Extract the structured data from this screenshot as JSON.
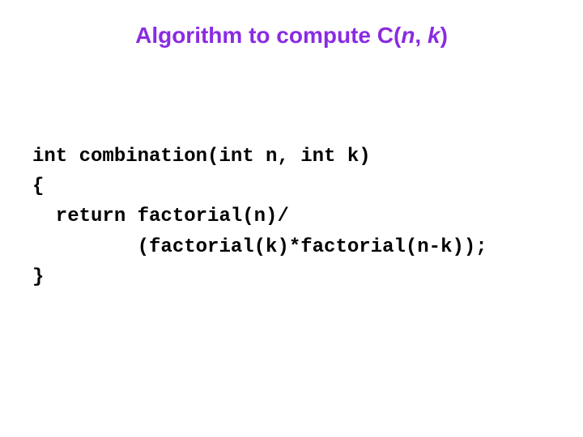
{
  "title": {
    "prefix": "Algorithm to compute ",
    "func": "C",
    "open": "(",
    "arg1": "n",
    "sep": ", ",
    "arg2": "k",
    "close": ")"
  },
  "code": {
    "line1": "int combination(int n, int k)",
    "line2": "{",
    "line3": "  return factorial(n)/",
    "line4": "         (factorial(k)*factorial(n-k));",
    "line5": "}"
  }
}
